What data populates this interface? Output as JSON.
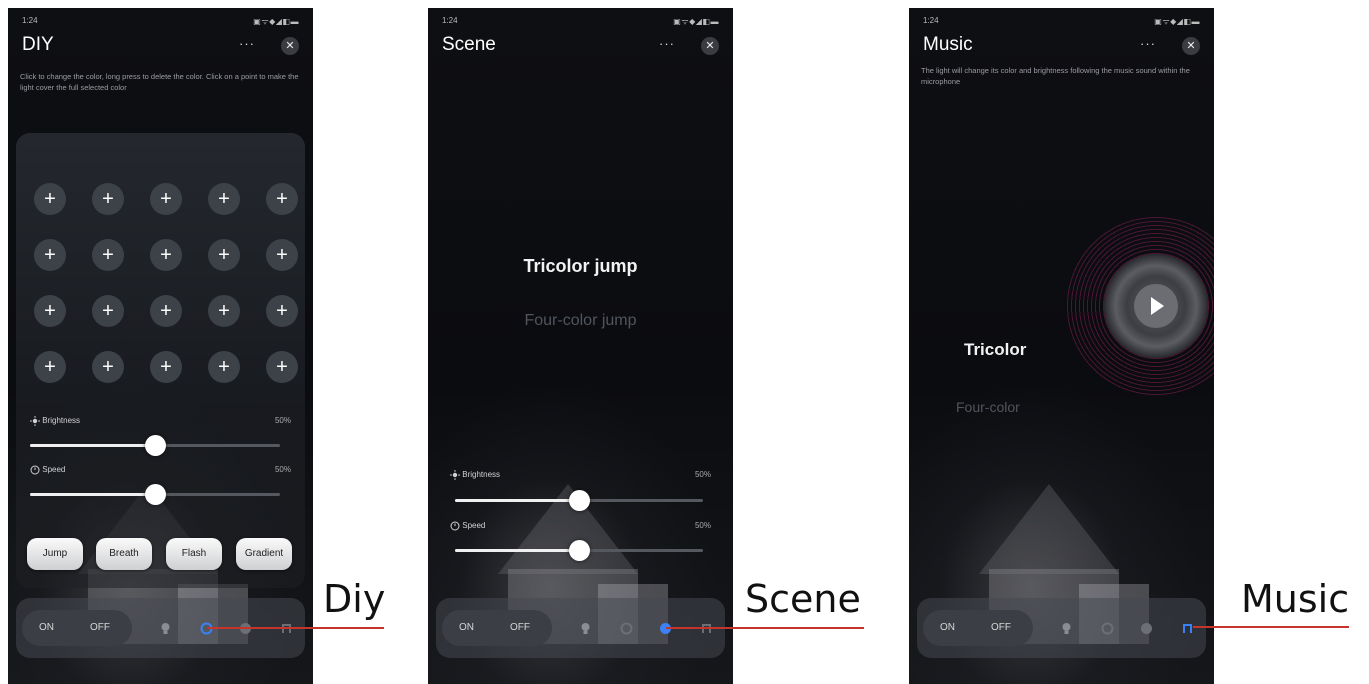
{
  "status": {
    "time": "1:24",
    "icons": "▣ᯤ◆◢◧▬"
  },
  "screens": [
    {
      "title": "DIY",
      "more": "···",
      "close": "✕",
      "description": "Click to change the color, long press to delete the color. Click on a point to make the light cover the full selected color",
      "grid_symbol": "+",
      "sliders": [
        {
          "label": "Brightness",
          "value_text": "50%",
          "value": 50
        },
        {
          "label": "Speed",
          "value_text": "50%",
          "value": 50
        }
      ],
      "modes": [
        "Jump",
        "Breath",
        "Flash",
        "Gradient"
      ],
      "on_label": "ON",
      "off_label": "OFF",
      "active_tab": "diy"
    },
    {
      "title": "Scene",
      "more": "···",
      "close": "✕",
      "scene_active": "Tricolor jump",
      "scene_inactive": "Four-color jump",
      "sliders": [
        {
          "label": "Brightness",
          "value_text": "50%",
          "value": 50
        },
        {
          "label": "Speed",
          "value_text": "50%",
          "value": 50
        }
      ],
      "on_label": "ON",
      "off_label": "OFF",
      "active_tab": "scene"
    },
    {
      "title": "Music",
      "more": "···",
      "close": "✕",
      "description": "The light will change its color and brightness following the music sound within the microphone",
      "music_active": "Tricolor",
      "music_inactive": "Four-color",
      "on_label": "ON",
      "off_label": "OFF",
      "active_tab": "music"
    }
  ],
  "labels": {
    "diy": "Diy",
    "scene": "Scene",
    "music": "Music"
  },
  "colors": {
    "pointer": "#c5352c",
    "active_tab": "#3b82f6"
  }
}
